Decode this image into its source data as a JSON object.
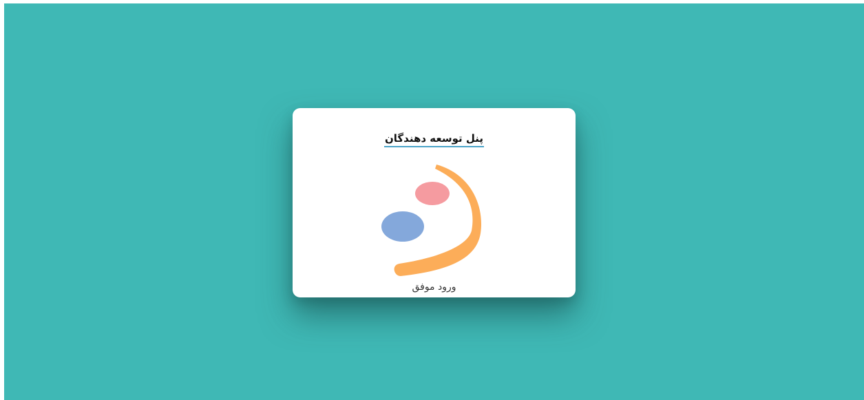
{
  "page": {
    "background_color": "#3fb8b5"
  },
  "card": {
    "title": "پنل توسعه دهندگان",
    "logo_icon": "brand-logo-icon",
    "status_text": "ورود موفق",
    "colors": {
      "arc": "#fcad59",
      "pink_dot": "#f59ba0",
      "blue_dot": "#84a8db",
      "title_underline": "#4aa3c8"
    }
  }
}
